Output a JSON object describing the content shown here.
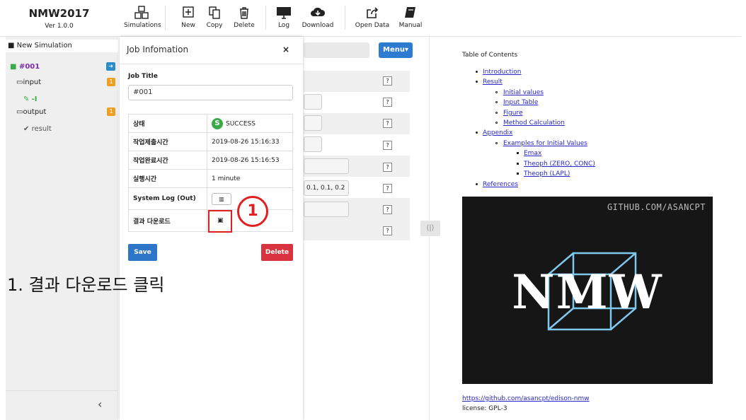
{
  "app": {
    "name": "NMW2017",
    "version": "Ver 1.0.0"
  },
  "toolbar": {
    "simulations": "Simulations",
    "new": "New",
    "copy": "Copy",
    "delete": "Delete",
    "log": "Log",
    "download": "Download",
    "open_data": "Open Data",
    "manual": "Manual"
  },
  "sidebar": {
    "new_simulation": "New Simulation",
    "sim_id": "#001",
    "input": "input",
    "input_badge": "1",
    "input_sub": "-I",
    "output": "output",
    "output_badge": "1",
    "result": "result"
  },
  "center": {
    "menu": "Menu▾",
    "field_value": "0.1, 0.1, 0.2",
    "q": "?"
  },
  "modal": {
    "title": "Job Infomation",
    "close": "×",
    "job_title_label": "Job Title",
    "job_title_value": "#001",
    "rows": [
      {
        "key": "상태",
        "value": "SUCCESS"
      },
      {
        "key": "작업제출시간",
        "value": "2019-08-26 15:16:33"
      },
      {
        "key": "작업완료시간",
        "value": "2019-08-26 15:16:53"
      },
      {
        "key": "실행시간",
        "value": "1 minute"
      },
      {
        "key": "System Log (Out)",
        "value": ""
      },
      {
        "key": "결과 다운로드",
        "value": ""
      }
    ],
    "status_letter": "S",
    "step_number": "1",
    "save": "Save",
    "delete": "Delete"
  },
  "instruction": "1. 결과 다운로드 클릭",
  "doc": {
    "toc_title": "Table of Contents",
    "toc": {
      "introduction": "Introduction",
      "result": "Result",
      "initial_values": "Initial values",
      "input_table": "Input Table",
      "figure": "Figure",
      "method_calc": "Method Calculation",
      "appendix": "Appendix",
      "examples": "Examples for Initial Values",
      "emax": "Emax",
      "theoph_zero": "Theoph (ZERO, CONC)",
      "theoph_lapl": "Theoph (LAPL)",
      "references": "References"
    },
    "logo_site": "GITHUB.COM/ASANCPT",
    "logo_text": "NMW",
    "link": "https://github.com/asancpt/edison-nmw",
    "license": "license: GPL-3"
  },
  "colors": {
    "accent": "#2e7bd2",
    "danger": "#d9333f",
    "success": "#3aaa48",
    "highlight": "#e02020",
    "logo_cube": "#7ec8f0"
  }
}
